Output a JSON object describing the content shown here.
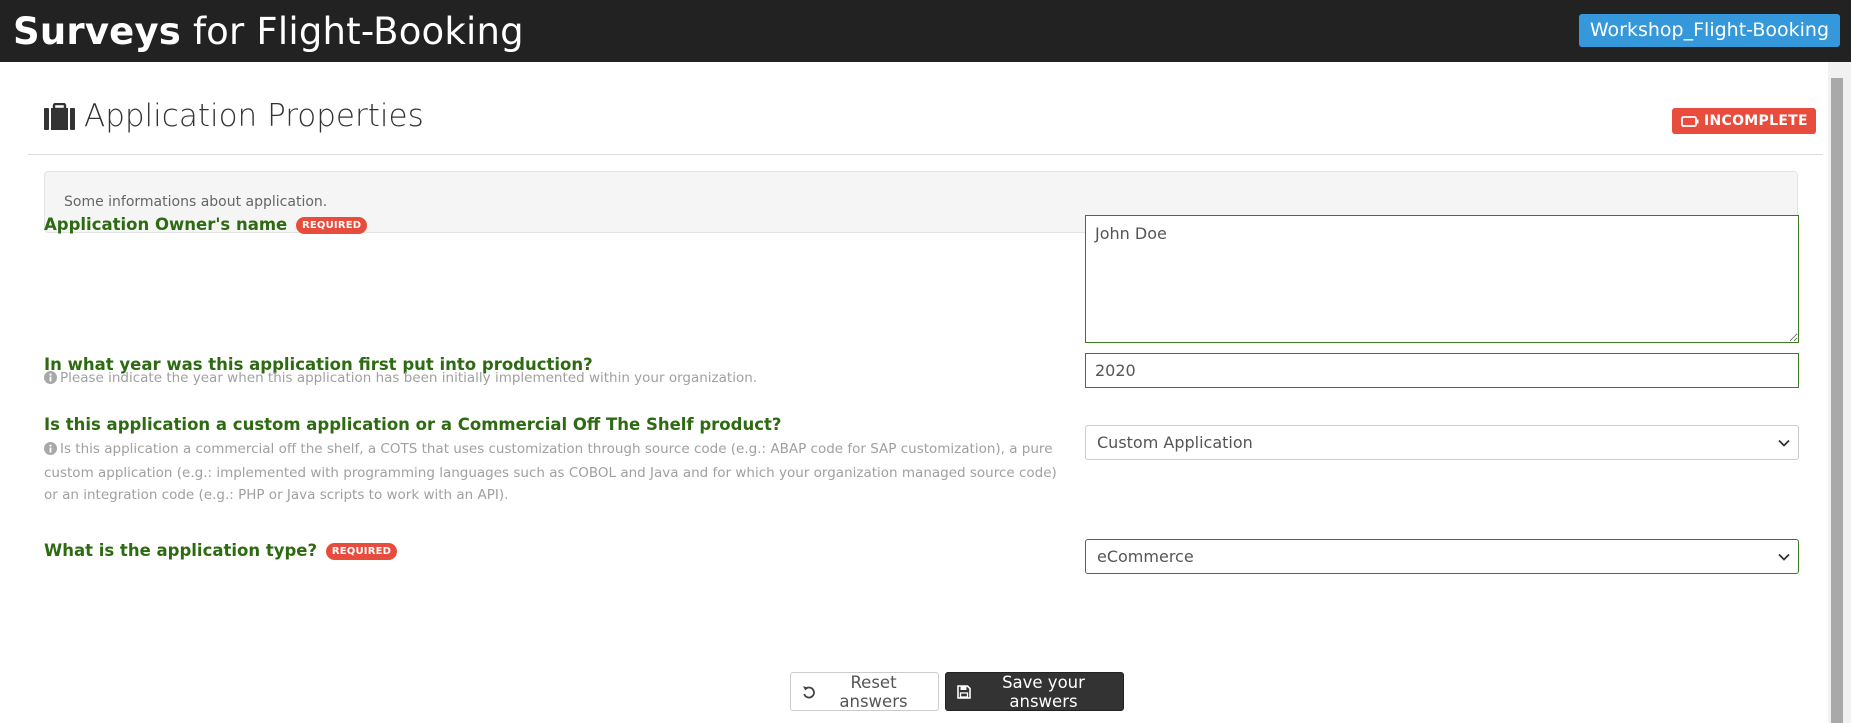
{
  "header": {
    "title_strong": "Surveys",
    "title_rest": " for Flight-Booking",
    "project_button": "Workshop_Flight-Booking"
  },
  "section": {
    "title": "Application Properties",
    "status": "INCOMPLETE",
    "description": "Some informations about application."
  },
  "questions": [
    {
      "label": "Application Owner's name",
      "required_badge": "REQUIRED",
      "value": "John Doe"
    },
    {
      "label": "In what year was this application first put into production?",
      "help": "Please indicate the year when this application has been initially implemented within your organization.",
      "value": "2020"
    },
    {
      "label": "Is this application a custom application or a Commercial Off The Shelf product?",
      "help": "Is this application a commercial off the shelf, a COTS that uses customization through source code (e.g.: ABAP code for SAP customization), a pure custom application (e.g.: implemented with programming languages such as COBOL and Java and for which your organization managed source code) or an integration code (e.g.: PHP or Java scripts to work with an API).",
      "value": "Custom Application"
    },
    {
      "label": "What is the application type?",
      "required_badge": "REQUIRED",
      "value": "eCommerce"
    }
  ],
  "buttons": {
    "reset": "Reset answers",
    "save": "Save your answers"
  },
  "colors": {
    "header_bg": "#222222",
    "project_button_bg": "#3498db",
    "danger": "#e74c3c",
    "label_green": "#2d6a12"
  },
  "icons": {
    "section": "briefcase-icon",
    "status": "battery-empty-icon",
    "help": "info-circle-icon",
    "reset": "undo-icon",
    "save": "floppy-disk-icon"
  }
}
